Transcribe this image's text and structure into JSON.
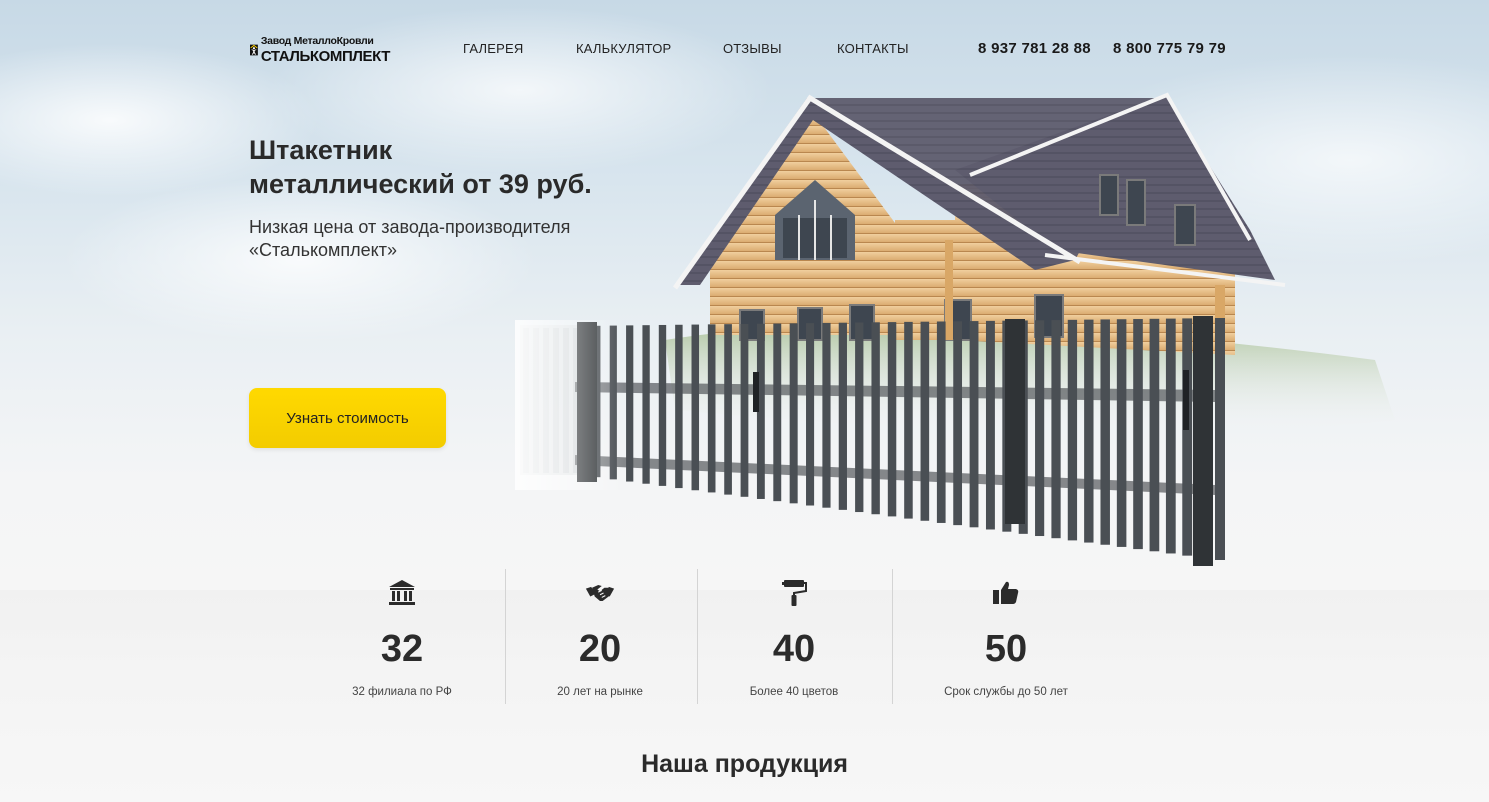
{
  "brand": {
    "line1": "Завод МеталлоКровли",
    "line2": "СТАЛЬКОМПЛЕКТ",
    "icon": "logo-man-icon"
  },
  "nav": {
    "gallery": "ГАЛЕРЕЯ",
    "calculator": "КАЛЬКУЛЯТОР",
    "reviews": "ОТЗЫВЫ",
    "contacts": "КОНТАКТЫ"
  },
  "phones": {
    "phone1": "8 937 781 28 88",
    "phone2": "8 800 775 79 79"
  },
  "hero": {
    "title_line1": "Штакетник",
    "title_line2": "металлический от 39 руб.",
    "subtitle_line1": "Низкая цена от завода-производителя",
    "subtitle_line2": "«Сталькомплект»",
    "cta_label": "Узнать стоимость"
  },
  "stats": [
    {
      "icon": "bank-building-icon",
      "number": "32",
      "label": "32 филиала по РФ"
    },
    {
      "icon": "handshake-icon",
      "number": "20",
      "label": "20 лет на рынке"
    },
    {
      "icon": "paint-roller-icon",
      "number": "40",
      "label": "Более 40 цветов"
    },
    {
      "icon": "thumbs-up-icon",
      "number": "50",
      "label": "Срок службы до 50 лет"
    }
  ],
  "products": {
    "title": "Наша продукция"
  },
  "colors": {
    "accent": "#ffd900",
    "text": "#2b2b2b",
    "fence": "#4a4f54",
    "roof": "#5b5a6b",
    "wood": "#e2b57a"
  }
}
